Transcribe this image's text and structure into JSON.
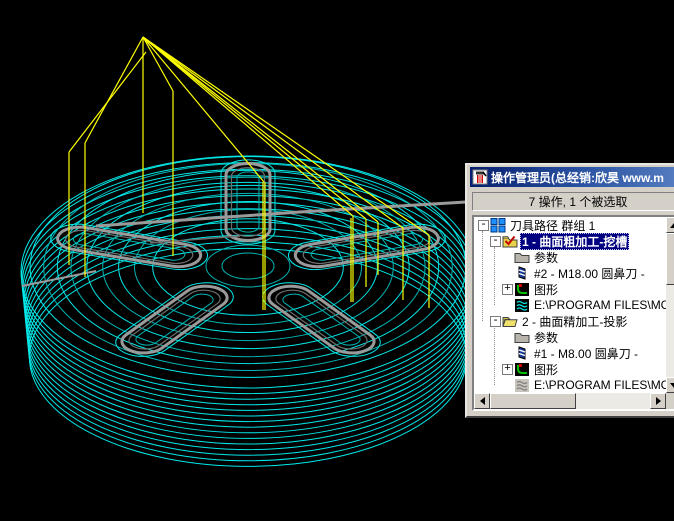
{
  "viewport": {
    "description": "CAD toolpath view: circular pocketed part wireframe with rapid moves",
    "colors": {
      "background": "#000000",
      "toolpath": "#00e8e8",
      "toolpath_dim": "#00b4b4",
      "rapid": "#ffff00",
      "surface": "#9a9a9a",
      "surface_dark": "#6e6e6e"
    }
  },
  "window": {
    "title": "操作管理员(总经销:欣昊 www.m",
    "status": "7 操作, 1 个被选取",
    "tree": {
      "expand_glyph": "+",
      "collapse_glyph": "-",
      "items": [
        {
          "label": "刀具路径 群组 1",
          "level": 0,
          "expander": "collapse",
          "icon": "toolpath-group",
          "selected": false
        },
        {
          "label": "1 - 曲面粗加工-挖槽",
          "level": 1,
          "expander": "collapse",
          "icon": "folder-checked",
          "selected": true
        },
        {
          "label": "参数",
          "level": 2,
          "expander": "none",
          "icon": "folder-gray",
          "selected": false
        },
        {
          "label": "#2 - M18.00 圆鼻刀 -",
          "level": 2,
          "expander": "none",
          "icon": "tool-flag",
          "selected": false
        },
        {
          "label": "图形",
          "level": 2,
          "expander": "expand",
          "icon": "geometry",
          "selected": false
        },
        {
          "label": "E:\\PROGRAM FILES\\MC",
          "level": 2,
          "expander": "none",
          "icon": "nc-file",
          "selected": false
        },
        {
          "label": "2 - 曲面精加工-投影",
          "level": 1,
          "expander": "collapse",
          "icon": "folder-open",
          "selected": false
        },
        {
          "label": "参数",
          "level": 2,
          "expander": "none",
          "icon": "folder-gray",
          "selected": false
        },
        {
          "label": "#1 - M8.00 圆鼻刀 -",
          "level": 2,
          "expander": "none",
          "icon": "tool-flag",
          "selected": false
        },
        {
          "label": "图形",
          "level": 2,
          "expander": "expand",
          "icon": "geometry",
          "selected": false
        },
        {
          "label": "E:\\PROGRAM FILES\\MC",
          "level": 2,
          "expander": "none",
          "icon": "nc-file-gray",
          "selected": false
        }
      ]
    }
  }
}
